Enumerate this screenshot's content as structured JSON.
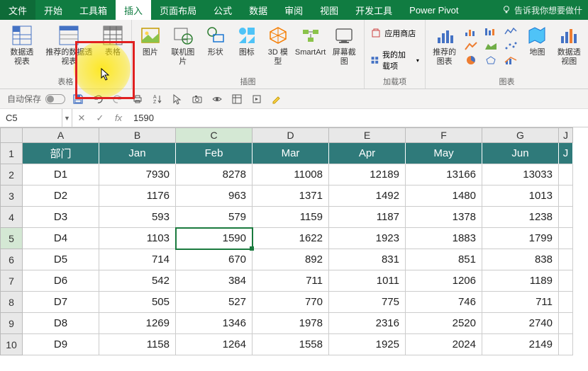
{
  "menubar": {
    "items": [
      "文件",
      "开始",
      "工具箱",
      "插入",
      "页面布局",
      "公式",
      "数据",
      "审阅",
      "视图",
      "开发工具",
      "Power Pivot"
    ],
    "active_index": 3,
    "tell_me": "告诉我你想要做什"
  },
  "ribbon": {
    "groups": [
      {
        "label": "表格",
        "buttons": [
          "数据透视表",
          "推荐的数据透视表",
          "表格"
        ]
      },
      {
        "label": "插图",
        "buttons": [
          "图片",
          "联机图片",
          "形状",
          "图标",
          "3D 模型",
          "SmartArt",
          "屏幕截图"
        ]
      },
      {
        "label": "加载项",
        "items": [
          "应用商店",
          "我的加载项"
        ]
      },
      {
        "label": "图表",
        "buttons": [
          "推荐的图表",
          "地图",
          "数据透视图"
        ]
      }
    ]
  },
  "qat": {
    "autosave": "自动保存"
  },
  "formula_bar": {
    "name_box": "C5",
    "fx": "fx",
    "value": "1590"
  },
  "columns": [
    "A",
    "B",
    "C",
    "D",
    "E",
    "F",
    "G",
    "J"
  ],
  "headers": [
    "部门",
    "Jan",
    "Feb",
    "Mar",
    "Apr",
    "May",
    "Jun",
    "J"
  ],
  "rows": [
    {
      "r": 1
    },
    {
      "r": 2,
      "dept": "D1",
      "vals": [
        7930,
        8278,
        11008,
        12189,
        13166,
        13033
      ]
    },
    {
      "r": 3,
      "dept": "D2",
      "vals": [
        1176,
        963,
        1371,
        1492,
        1480,
        1013
      ]
    },
    {
      "r": 4,
      "dept": "D3",
      "vals": [
        593,
        579,
        1159,
        1187,
        1378,
        1238
      ]
    },
    {
      "r": 5,
      "dept": "D4",
      "vals": [
        1103,
        1590,
        1622,
        1923,
        1883,
        1799
      ]
    },
    {
      "r": 6,
      "dept": "D5",
      "vals": [
        714,
        670,
        892,
        831,
        851,
        838
      ]
    },
    {
      "r": 7,
      "dept": "D6",
      "vals": [
        542,
        384,
        711,
        1011,
        1206,
        1189
      ]
    },
    {
      "r": 8,
      "dept": "D7",
      "vals": [
        505,
        527,
        770,
        775,
        746,
        711
      ]
    },
    {
      "r": 9,
      "dept": "D8",
      "vals": [
        1269,
        1346,
        1978,
        2316,
        2520,
        2740
      ]
    },
    {
      "r": 10,
      "dept": "D9",
      "vals": [
        1158,
        1264,
        1558,
        1925,
        2024,
        2149
      ]
    }
  ],
  "active_cell": {
    "row": 5,
    "col": "C"
  },
  "chart_data": {
    "type": "table",
    "title": "",
    "columns": [
      "部门",
      "Jan",
      "Feb",
      "Mar",
      "Apr",
      "May",
      "Jun"
    ],
    "rows": [
      [
        "D1",
        7930,
        8278,
        11008,
        12189,
        13166,
        13033
      ],
      [
        "D2",
        1176,
        963,
        1371,
        1492,
        1480,
        1013
      ],
      [
        "D3",
        593,
        579,
        1159,
        1187,
        1378,
        1238
      ],
      [
        "D4",
        1103,
        1590,
        1622,
        1923,
        1883,
        1799
      ],
      [
        "D5",
        714,
        670,
        892,
        831,
        851,
        838
      ],
      [
        "D6",
        542,
        384,
        711,
        1011,
        1206,
        1189
      ],
      [
        "D7",
        505,
        527,
        770,
        775,
        746,
        711
      ],
      [
        "D8",
        1269,
        1346,
        1978,
        2316,
        2520,
        2740
      ],
      [
        "D9",
        1158,
        1264,
        1558,
        1925,
        2024,
        2149
      ]
    ]
  }
}
